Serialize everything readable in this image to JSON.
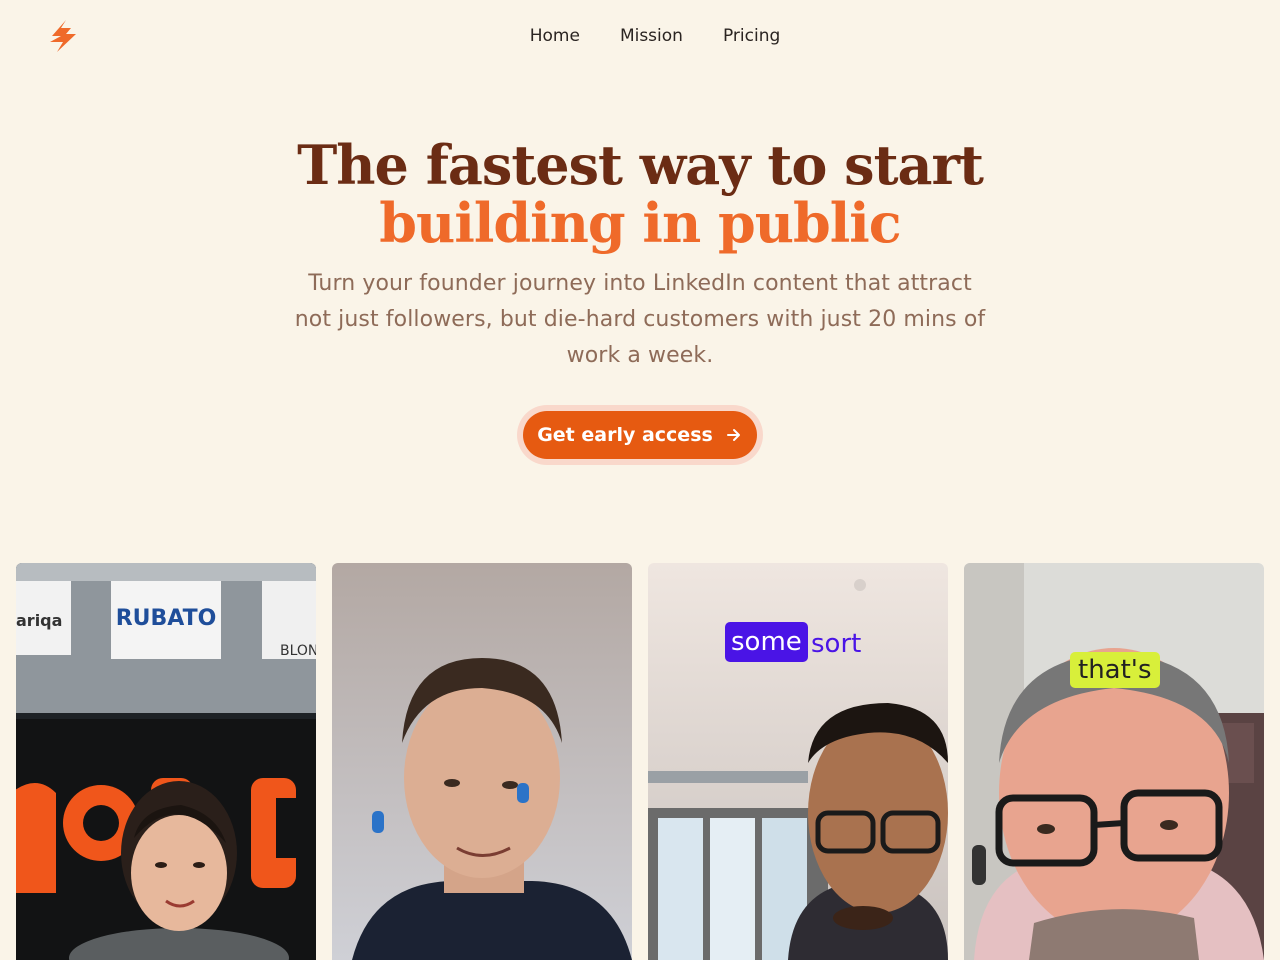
{
  "brand": {
    "logo_icon": "lightning-bolt-icon",
    "accent": "#ef6a2a"
  },
  "nav": {
    "items": [
      "Home",
      "Mission",
      "Pricing"
    ]
  },
  "hero": {
    "title_line1": "The fastest way to start",
    "title_line2": "building in public",
    "subtitle": "Turn your founder journey into LinkedIn content that attract not just followers, but die-hard customers with just 20 mins of work a week.",
    "cta_label": "Get early access",
    "cta_icon": "arrow-right-icon",
    "cta_color": "#e65a11"
  },
  "videos": {
    "card1": {
      "banner_text": "RUBATO",
      "banner_left": "ariqa",
      "banner_right": "BLON"
    },
    "card3": {
      "caption_word1": "some",
      "caption_word2": "sort"
    },
    "card4": {
      "caption": "that's"
    }
  }
}
